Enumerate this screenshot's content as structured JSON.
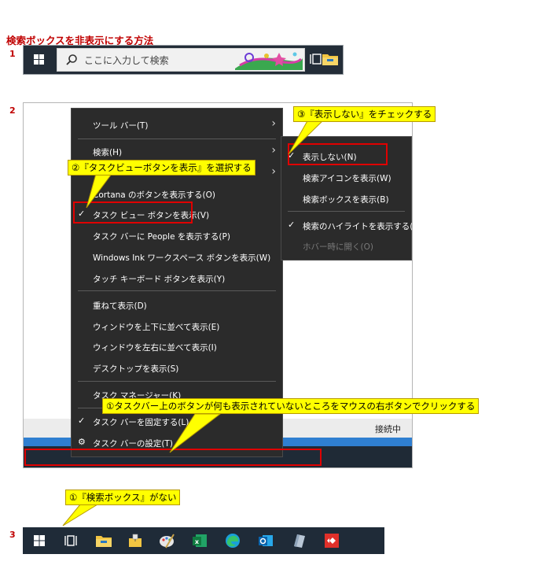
{
  "title": "検索ボックスを非表示にする方法",
  "sections": {
    "s1": {
      "number": "1",
      "search_placeholder": "ここに入力して検索"
    },
    "s2": {
      "number": "2",
      "status_text": "接続中",
      "context_menu": {
        "items": [
          {
            "label": "ツール バー(T)"
          },
          {
            "label": "検索(H)"
          },
          {
            "label": "Cortana のボタンを表示する(O)"
          },
          {
            "label": "タスク ビュー ボタンを表示(V)"
          },
          {
            "label": "タスク バーに People を表示する(P)"
          },
          {
            "label": "Windows Ink ワークスペース ボタンを表示(W)"
          },
          {
            "label": "タッチ キーボード ボタンを表示(Y)"
          },
          {
            "label": "重ねて表示(D)"
          },
          {
            "label": "ウィンドウを上下に並べて表示(E)"
          },
          {
            "label": "ウィンドウを左右に並べて表示(I)"
          },
          {
            "label": "デスクトップを表示(S)"
          },
          {
            "label": "タスク マネージャー(K)"
          },
          {
            "label": "タスク バーを固定する(L)"
          },
          {
            "label": "タスク バーの設定(T)"
          }
        ]
      },
      "submenu": {
        "items": [
          {
            "label": "表示しない(N)"
          },
          {
            "label": "検索アイコンを表示(W)"
          },
          {
            "label": "検索ボックスを表示(B)"
          },
          {
            "label": "検索のハイライトを表示する(H)"
          },
          {
            "label": "ホバー時に開く(O)"
          }
        ]
      },
      "callouts": {
        "step1": "①タスクバー上のボタンが何も表示されていないところをマウスの右ボタンでクリックする",
        "step2": "②『タスクビューボタンを表示』を選択する",
        "step3": "③『表示しない』をチェックする"
      }
    },
    "s3": {
      "number": "3",
      "callout": "①『検索ボックス』がない"
    }
  }
}
